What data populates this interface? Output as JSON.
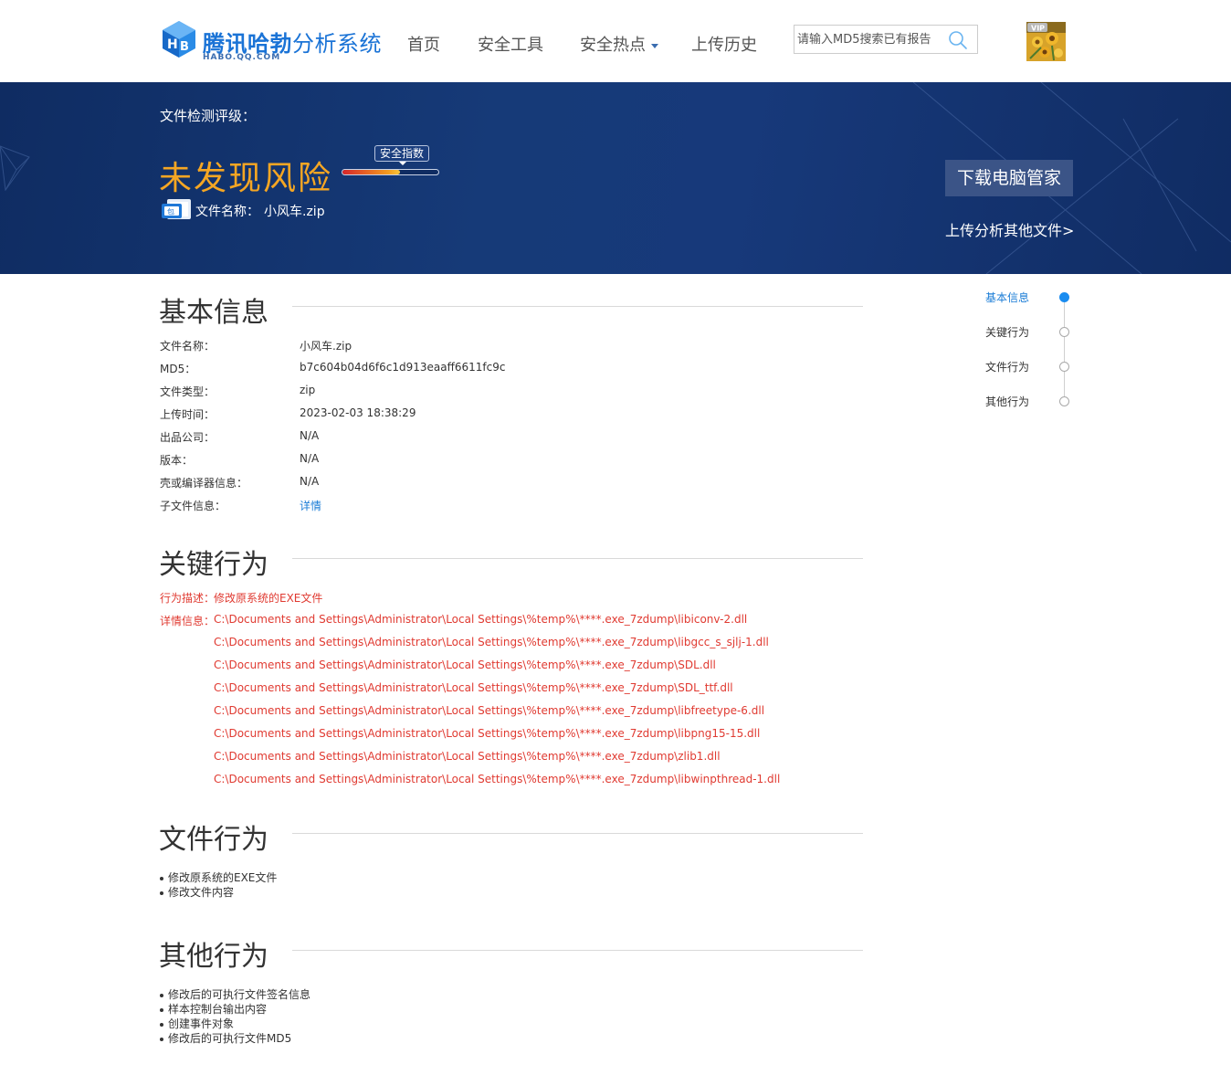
{
  "header": {
    "logo_title_strong": "腾讯哈勃",
    "logo_title_light": "分析系统",
    "logo_subtitle": "HABO.QQ.COM",
    "nav": [
      {
        "label": "首页"
      },
      {
        "label": "安全工具"
      },
      {
        "label": "安全热点"
      },
      {
        "label": "上传历史"
      }
    ],
    "search_placeholder": "请输入MD5搜索已有报告",
    "search_value": "",
    "avatar_badge": "VIP"
  },
  "banner": {
    "rating_label": "文件检测评级：",
    "verdict": "未发现风险",
    "index_badge": "安全指数",
    "index_level": 0.6,
    "filename_label": "文件名称：",
    "filename_value": "小风车.zip",
    "file_icon_text": "包",
    "download_button": "下载电脑管家",
    "upload_link": "上传分析其他文件>"
  },
  "sections": {
    "basic": {
      "title": "基本信息",
      "rows": [
        {
          "key": "文件名称：",
          "value": "小风车.zip"
        },
        {
          "key": "MD5：",
          "value": "b7c604b04d6f6c1d913eaaff6611fc9c"
        },
        {
          "key": "文件类型：",
          "value": "zip"
        },
        {
          "key": "上传时间：",
          "value": "2023-02-03 18:38:29"
        },
        {
          "key": "出品公司：",
          "value": "N/A"
        },
        {
          "key": "版本：",
          "value": "N/A"
        },
        {
          "key": "壳或编译器信息：",
          "value": "N/A"
        },
        {
          "key": "子文件信息：",
          "value": "详情"
        }
      ]
    },
    "key_behavior": {
      "title": "关键行为",
      "desc_label": "行为描述：",
      "desc_value": "修改原系统的EXE文件",
      "detail_label": "详情信息：",
      "details": [
        "C:\\Documents and Settings\\Administrator\\Local Settings\\%temp%\\****.exe_7zdump\\libiconv-2.dll",
        "C:\\Documents and Settings\\Administrator\\Local Settings\\%temp%\\****.exe_7zdump\\libgcc_s_sjlj-1.dll",
        "C:\\Documents and Settings\\Administrator\\Local Settings\\%temp%\\****.exe_7zdump\\SDL.dll",
        "C:\\Documents and Settings\\Administrator\\Local Settings\\%temp%\\****.exe_7zdump\\SDL_ttf.dll",
        "C:\\Documents and Settings\\Administrator\\Local Settings\\%temp%\\****.exe_7zdump\\libfreetype-6.dll",
        "C:\\Documents and Settings\\Administrator\\Local Settings\\%temp%\\****.exe_7zdump\\libpng15-15.dll",
        "C:\\Documents and Settings\\Administrator\\Local Settings\\%temp%\\****.exe_7zdump\\zlib1.dll",
        "C:\\Documents and Settings\\Administrator\\Local Settings\\%temp%\\****.exe_7zdump\\libwinpthread-1.dll"
      ]
    },
    "file_behavior": {
      "title": "文件行为",
      "items": [
        "修改原系统的EXE文件",
        "修改文件内容"
      ]
    },
    "other_behavior": {
      "title": "其他行为",
      "items": [
        "修改后的可执行文件签名信息",
        "样本控制台输出内容",
        "创建事件对象",
        "修改后的可执行文件MD5"
      ]
    }
  },
  "timeline": {
    "items": [
      {
        "label": "基本信息",
        "active": true
      },
      {
        "label": "关键行为",
        "active": false
      },
      {
        "label": "文件行为",
        "active": false
      },
      {
        "label": "其他行为",
        "active": false
      }
    ]
  },
  "colors": {
    "brand_blue": "#1a73d6",
    "banner_bg": "#163a78",
    "verdict_orange": "#f5a623",
    "alert_red": "#e03a31",
    "link_blue": "#1a7cd6"
  }
}
